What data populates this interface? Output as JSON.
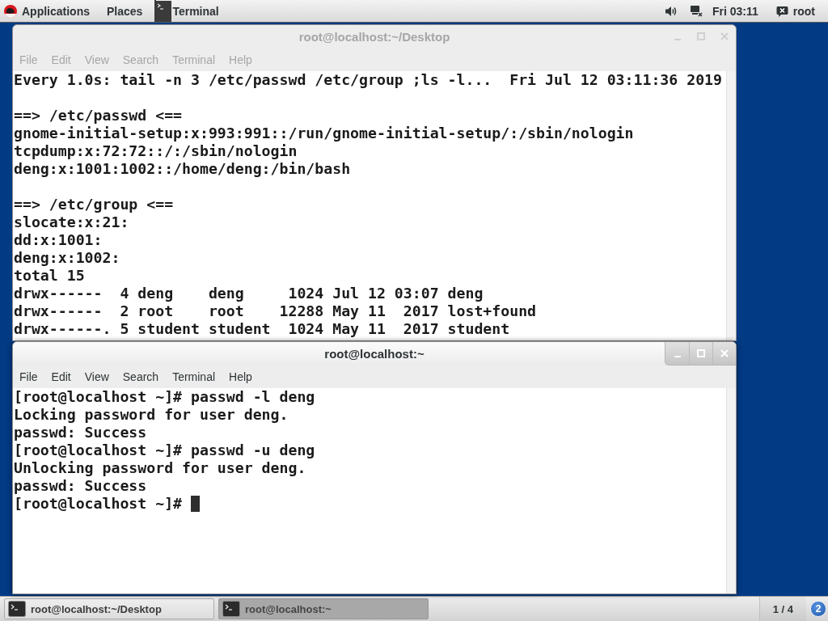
{
  "top_bar": {
    "menus": [
      {
        "label": "Applications"
      },
      {
        "label": "Places"
      }
    ],
    "app": "Terminal",
    "clock": "Fri 03:11",
    "user": "root"
  },
  "windows": [
    {
      "title": "root@localhost:~/Desktop",
      "active": false,
      "cursor": false,
      "menu": [
        "File",
        "Edit",
        "View",
        "Search",
        "Terminal",
        "Help"
      ],
      "blocks": [
        [
          "Every 1.0s: tail -n 3 /etc/passwd /etc/group ;ls -l...  Fri Jul 12 03:11:36 2019"
        ],
        [
          "==> /etc/passwd <==",
          "gnome-initial-setup:x:993:991::/run/gnome-initial-setup/:/sbin/nologin",
          "tcpdump:x:72:72::/:/sbin/nologin",
          "deng:x:1001:1002::/home/deng:/bin/bash"
        ],
        [
          "==> /etc/group <==",
          "slocate:x:21:",
          "dd:x:1001:",
          "deng:x:1002:",
          "total 15",
          "drwx------  4 deng    deng     1024 Jul 12 03:07 deng",
          "drwx------  2 root    root    12288 May 11  2017 lost+found",
          "drwx------. 5 student student  1024 May 11  2017 student"
        ]
      ]
    },
    {
      "title": "root@localhost:~",
      "active": true,
      "cursor": true,
      "menu": [
        "File",
        "Edit",
        "View",
        "Search",
        "Terminal",
        "Help"
      ],
      "blocks": [
        [
          "[root@localhost ~]# passwd -l deng",
          "Locking password for user deng.",
          "passwd: Success",
          "[root@localhost ~]# passwd -u deng",
          "Unlocking password for user deng.",
          "passwd: Success",
          "[root@localhost ~]#"
        ]
      ]
    }
  ],
  "taskbar": {
    "items": [
      {
        "label": "root@localhost:~/Desktop",
        "selected": false
      },
      {
        "label": "root@localhost:~",
        "selected": true
      }
    ],
    "workspace": "1 / 4",
    "notifications": "2"
  }
}
